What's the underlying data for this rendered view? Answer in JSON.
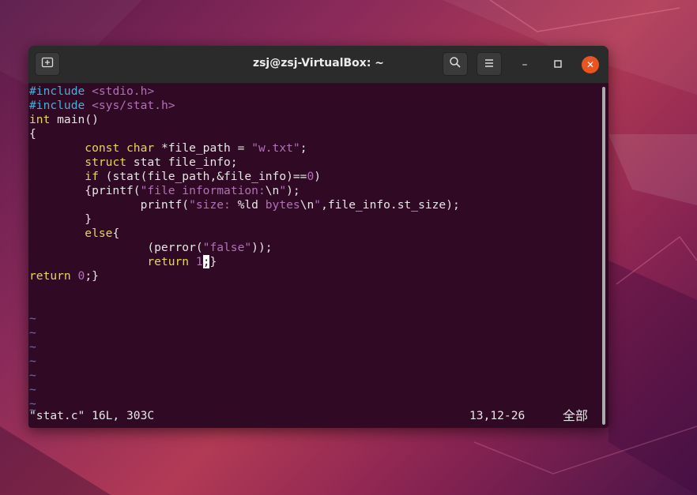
{
  "window": {
    "title": "zsj@zsj-VirtualBox: ~"
  },
  "titlebar": {
    "new_tab_icon": "new-tab-icon",
    "search_icon": "search-icon",
    "menu_icon": "hamburger-menu-icon",
    "minimize_label": "–",
    "maximize_icon": "maximize-icon",
    "close_label": "✕"
  },
  "code": {
    "l1_kw": "#include",
    "l1_arg": " <stdio.h>",
    "l2_kw": "#include",
    "l2_arg": " <sys/stat.h>",
    "l3_kw": "int",
    "l3_rest": " main()",
    "l4": "{",
    "l5_pre": "        ",
    "l5_kw": "const char",
    "l5_mid": " *file_path = ",
    "l5_str": "\"w.txt\"",
    "l5_end": ";",
    "l6_pre": "        ",
    "l6_kw": "struct",
    "l6_rest": " stat file_info;",
    "l7_pre": "        ",
    "l7_kw": "if",
    "l7_mid": " (stat(file_path,&file_info)==",
    "l7_num": "0",
    "l7_end": ")",
    "l8_pre": "        {printf(",
    "l8_str": "\"file information:",
    "l8_esc": "\\n",
    "l8_q": "\"",
    "l8_end": ");",
    "l9_pre": "                printf(",
    "l9_str": "\"size: ",
    "l9_fmt": "%ld",
    "l9_str2": " bytes",
    "l9_esc": "\\n",
    "l9_q": "\"",
    "l9_end": ",file_info.st_size);",
    "l10": "        }",
    "l11_pre": "        ",
    "l11_kw": "else",
    "l11_end": "{",
    "l12_pre": "                 (perror(",
    "l12_str": "\"false\"",
    "l12_end": "));",
    "l13_pre": "                 ",
    "l13_kw": "return",
    "l13_sp": " ",
    "l13_num": "1",
    "l13_cur": ";",
    "l13_end": "}",
    "l14_kw": "return",
    "l14_sp": " ",
    "l14_num": "0",
    "l14_end": ";}"
  },
  "tildes": [
    "~",
    "~",
    "~",
    "~",
    "~",
    "~",
    "~",
    "~"
  ],
  "status": {
    "file_info": "\"stat.c\" 16L, 303C",
    "position": "13,12-26",
    "scroll": "全部"
  }
}
